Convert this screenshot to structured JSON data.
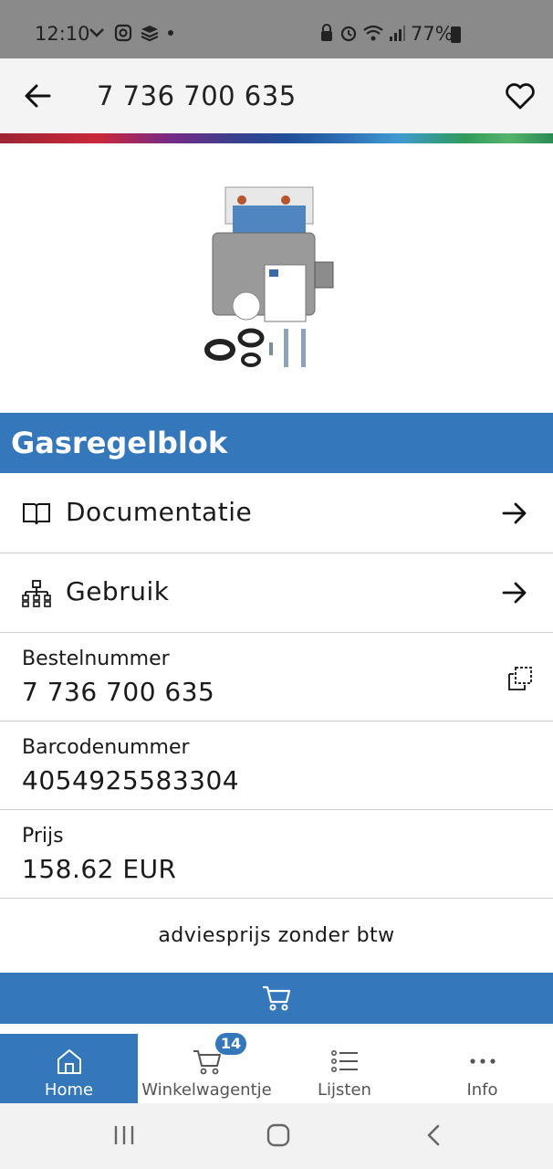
{
  "status_bar": {
    "time": "12:10",
    "battery": "77%"
  },
  "app_bar": {
    "title": "7 736 700 635"
  },
  "brand_colors": {
    "primary": "#3577bb"
  },
  "product": {
    "name": "Gasregelblok"
  },
  "links": [
    {
      "label": "Documentatie",
      "icon": "book-icon"
    },
    {
      "label": "Gebruik",
      "icon": "hierarchy-icon"
    }
  ],
  "details": {
    "order_number": {
      "label": "Bestelnummer",
      "value": "7 736 700 635"
    },
    "barcode": {
      "label": "Barcodenummer",
      "value": "4054925583304"
    },
    "price": {
      "label": "Prijs",
      "value": "158.62 EUR"
    }
  },
  "price_note": "adviesprijs zonder btw",
  "bottom_nav": {
    "tabs": [
      {
        "label": "Home",
        "icon": "home-icon",
        "active": true
      },
      {
        "label": "Winkelwagentje",
        "icon": "cart-icon"
      },
      {
        "label": "Lijsten",
        "icon": "list-icon"
      },
      {
        "label": "Info",
        "icon": "more-icon"
      }
    ],
    "cart_count": "14"
  }
}
